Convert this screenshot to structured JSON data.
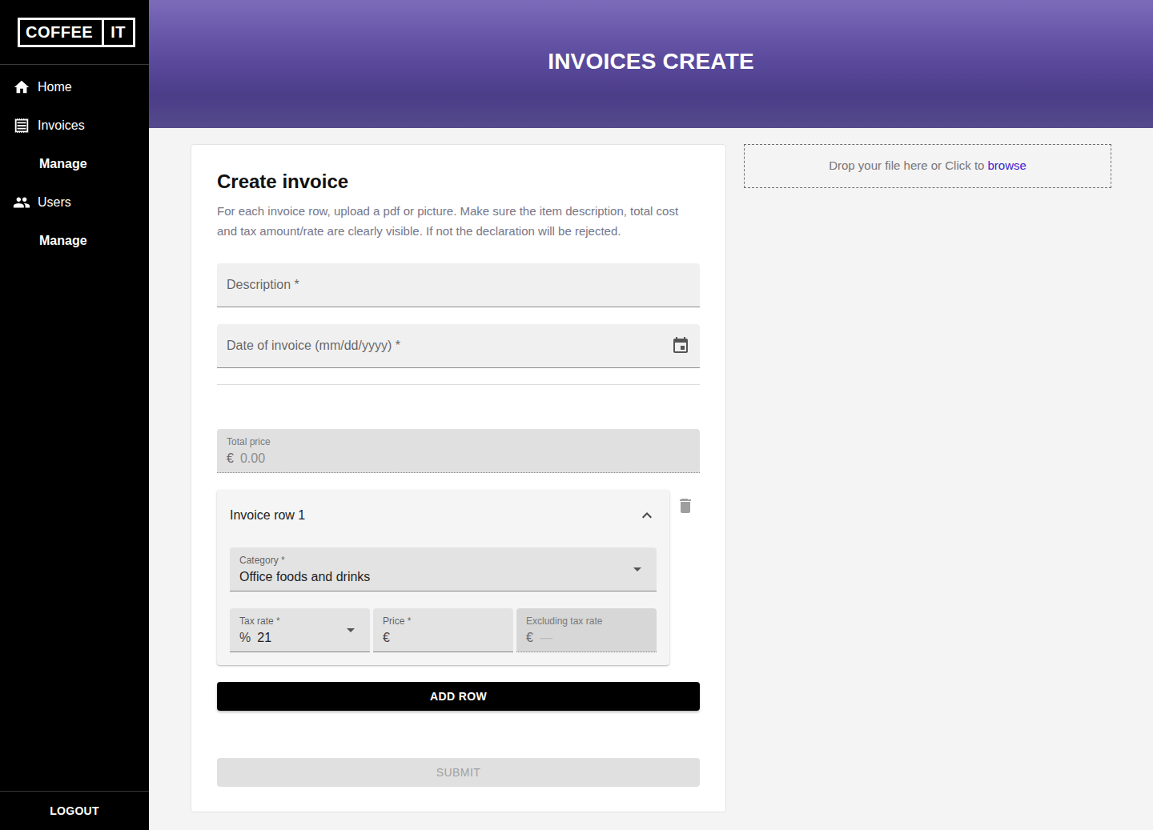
{
  "logo": {
    "left": "COFFEE",
    "right": "IT"
  },
  "sidebar": {
    "items": [
      {
        "label": "Home",
        "kind": "main"
      },
      {
        "label": "Invoices",
        "kind": "main"
      },
      {
        "label": "Manage",
        "kind": "sub"
      },
      {
        "label": "Users",
        "kind": "main"
      },
      {
        "label": "Manage",
        "kind": "sub"
      }
    ],
    "logout": "LOGOUT"
  },
  "header": {
    "title": "INVOICES CREATE"
  },
  "form": {
    "title": "Create invoice",
    "intro": "For each invoice row, upload a pdf or picture. Make sure the item description, total cost and tax amount/rate are clearly visible. If not the declaration will be rejected.",
    "description": {
      "label": "Description *",
      "kind": "text"
    },
    "date": {
      "label": "Date of invoice (mm/dd/yyyy) *",
      "kind": "date"
    },
    "total": {
      "label": "Total price",
      "prefix": "€",
      "value": "0.00",
      "kind": "text",
      "disabled": true
    },
    "rows": [
      {
        "title": "Invoice row 1",
        "expanded": true,
        "category": {
          "label": "Category *",
          "value": "Office foods and drinks",
          "kind": "select"
        },
        "tax": {
          "label": "Tax rate *",
          "prefix": "%",
          "value": "21",
          "kind": "select"
        },
        "price": {
          "label": "Price *",
          "prefix": "€",
          "kind": "text"
        },
        "excluding": {
          "label": "Excluding tax rate",
          "prefix": "€",
          "value": "—",
          "kind": "text",
          "disabled": true
        }
      }
    ],
    "add_row": "ADD ROW",
    "submit": {
      "label": "SUBMIT",
      "disabled": true
    }
  },
  "dropzone": {
    "text": "Drop your file here or Click to",
    "link": "browse"
  }
}
